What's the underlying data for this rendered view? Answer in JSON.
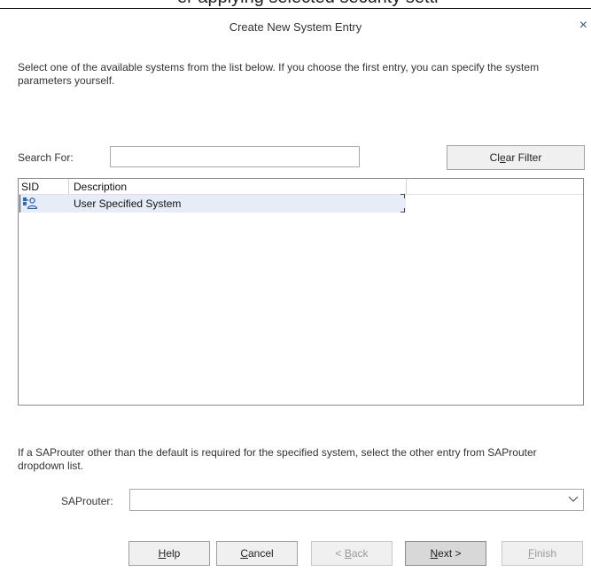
{
  "page_header_clipped_text": "er applying selected security setti",
  "dialog": {
    "title": "Create New System Entry",
    "close_label": "×"
  },
  "intro_text": "Select one of the available systems from the list below. If you choose the first entry, you can specify the system parameters yourself.",
  "search": {
    "label": "Search For:",
    "value": "",
    "placeholder": ""
  },
  "clear_filter_button": {
    "pre": "Cl",
    "mnemonic": "e",
    "post": "ar Filter"
  },
  "table": {
    "columns": [
      "SID",
      "Description"
    ],
    "rows": [
      {
        "sid_icon": "user-system-icon",
        "description": "User Specified System",
        "selected": true
      }
    ]
  },
  "saprouter": {
    "note": "If a SAProuter other than the default is required for the specified system, select the other entry from SAProuter dropdown list.",
    "label": "SAProuter:",
    "value": ""
  },
  "buttons": {
    "help": {
      "mnemonic": "H",
      "rest": "elp"
    },
    "cancel": {
      "mnemonic": "C",
      "rest": "ancel"
    },
    "back": {
      "pre": "< ",
      "mnemonic": "B",
      "rest": "ack"
    },
    "next": {
      "mnemonic": "N",
      "rest": "ext >"
    },
    "finish": {
      "mnemonic": "F",
      "rest": "inish"
    }
  },
  "colors": {
    "selected_row": "#e6edf6",
    "close_icon": "#2b5c8a",
    "disabled_text": "#9a9a9a"
  }
}
